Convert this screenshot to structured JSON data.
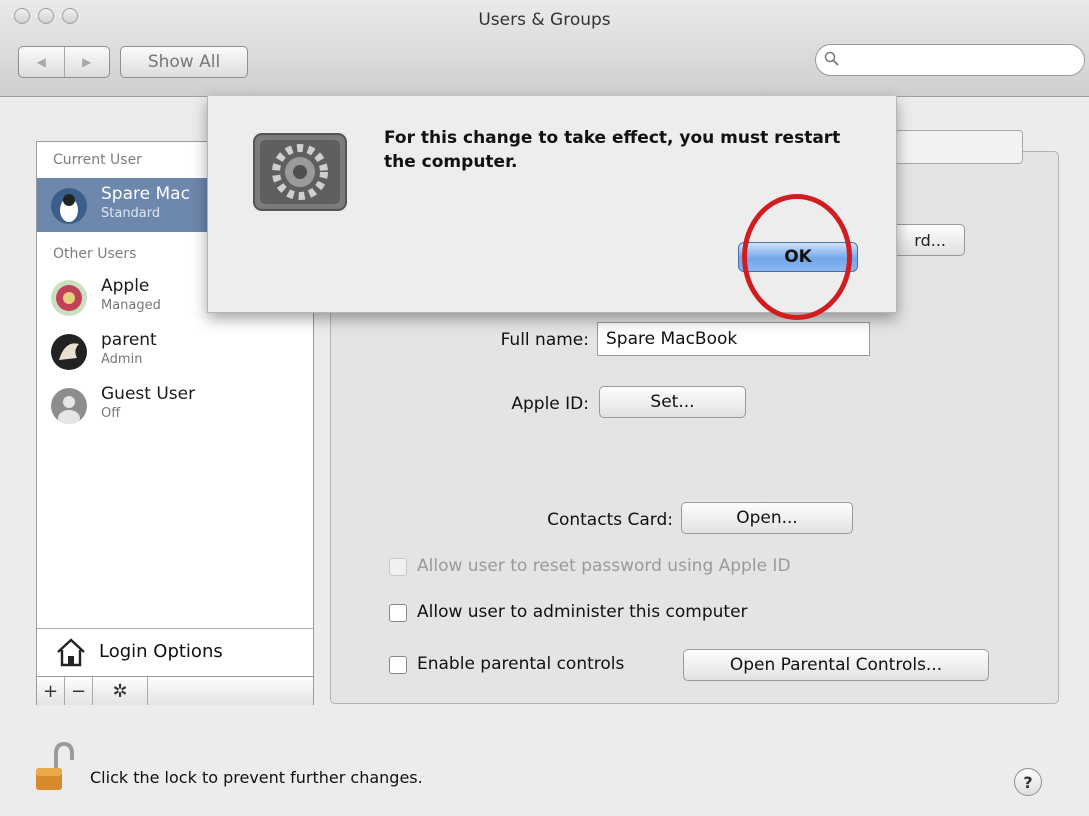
{
  "window": {
    "title": "Users & Groups"
  },
  "toolbar": {
    "back_label": "◀",
    "forward_label": "▶",
    "show_all_label": "Show All"
  },
  "search": {
    "placeholder": ""
  },
  "sidebar": {
    "current_user_heading": "Current User",
    "current_user": {
      "name": "Spare Mac",
      "role": "Standard"
    },
    "other_users_heading": "Other Users",
    "other_users": [
      {
        "name": "Apple",
        "role": "Managed"
      },
      {
        "name": "parent",
        "role": "Admin"
      },
      {
        "name": "Guest User",
        "role": "Off"
      }
    ],
    "login_options_label": "Login Options",
    "add_label": "+",
    "remove_label": "−",
    "actions_label": "✲"
  },
  "panel": {
    "password_button_label": "rd...",
    "full_name_label": "Full name:",
    "full_name_value": "Spare MacBook",
    "apple_id_label": "Apple ID:",
    "apple_id_button": "Set...",
    "contacts_label": "Contacts Card:",
    "contacts_button": "Open...",
    "checkbox_reset_password": "Allow user to reset password using Apple ID",
    "checkbox_administer": "Allow user to administer this computer",
    "checkbox_parental": "Enable parental controls",
    "parental_button": "Open Parental Controls..."
  },
  "footer": {
    "lock_text": "Click the lock to prevent further changes.",
    "help_label": "?"
  },
  "alert": {
    "message": "For this change to take effect, you must restart the computer.",
    "ok_label": "OK"
  },
  "colors": {
    "selection": "#6d87ad",
    "highlight_ring": "#d21d20",
    "default_button": "#73a6ea"
  }
}
